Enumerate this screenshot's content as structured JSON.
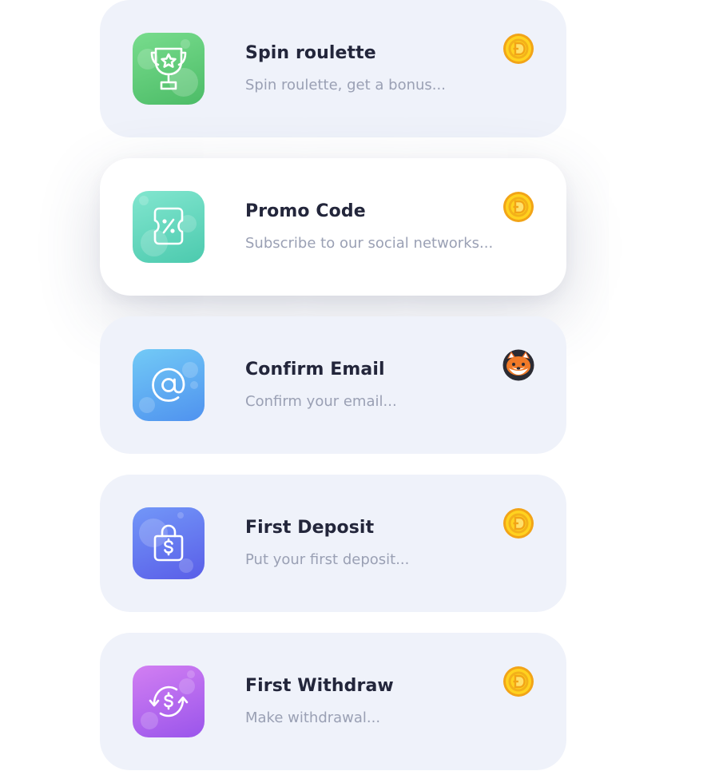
{
  "tasks": [
    {
      "title": "Spin roulette",
      "subtitle": "Spin roulette, get a bonus...",
      "icon": "trophy-icon",
      "reward_icon": "doge-coin-icon",
      "colors": {
        "from": "#74d98a",
        "to": "#4fbf6a"
      }
    },
    {
      "title": "Promo Code",
      "subtitle": "Subscribe to our social networks...",
      "icon": "ticket-percent-icon",
      "reward_icon": "doge-coin-icon",
      "colors": {
        "from": "#7de3cc",
        "to": "#4ccdb0"
      }
    },
    {
      "title": "Confirm Email",
      "subtitle": "Confirm your email...",
      "icon": "at-sign-icon",
      "reward_icon": "shiba-token-icon",
      "colors": {
        "from": "#6fc8f5",
        "to": "#4f95f0"
      }
    },
    {
      "title": "First Deposit",
      "subtitle": "Put your first deposit...",
      "icon": "money-bag-icon",
      "reward_icon": "doge-coin-icon",
      "colors": {
        "from": "#6f95f8",
        "to": "#5a63ea"
      }
    },
    {
      "title": "First Withdraw",
      "subtitle": "Make withdrawal...",
      "icon": "dollar-exchange-icon",
      "reward_icon": "doge-coin-icon",
      "colors": {
        "from": "#d47cf2",
        "to": "#9a56ec"
      }
    }
  ]
}
